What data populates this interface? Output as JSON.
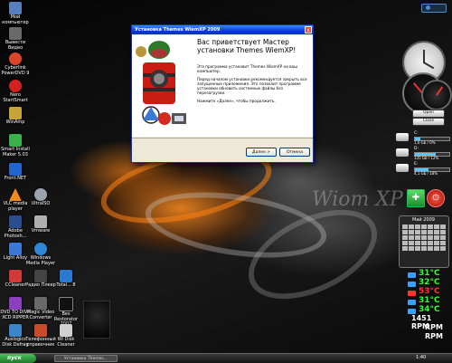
{
  "desktop": {
    "wallpaper_text": "Wiom XP",
    "icons": [
      {
        "label": "Мой компьютер",
        "color": "#5a7fbf"
      },
      {
        "label": "Вывести Видео",
        "color": "#6a6a6a"
      },
      {
        "label": "Cyberlink PowerDVD 9",
        "color": "#d9442a"
      },
      {
        "label": "Nero StartSmart",
        "color": "#d32020"
      },
      {
        "label": "WinAmp",
        "color": "#c7a43a"
      },
      {
        "label": "Smart Install Maker 5.03",
        "color": "#3cb04a"
      },
      {
        "label": "Front.NET",
        "color": "#2266cc"
      },
      {
        "label": "VLC media player",
        "color": "#f08a1c"
      },
      {
        "label": "UltraISO",
        "color": "#9aa3ad"
      },
      {
        "label": "Adobe Photosh...",
        "color": "#2a4d8f"
      },
      {
        "label": "Vmware",
        "color": "#b0b0b0"
      },
      {
        "label": "Light Alloy",
        "color": "#3a7ad4"
      },
      {
        "label": "Windows Media Player",
        "color": "#2f86d6"
      },
      {
        "label": "CCleaner",
        "color": "#d23a3a"
      },
      {
        "label": "Радио Плеер",
        "color": "#444444"
      },
      {
        "label": "Total... 8",
        "color": "#2b79d0"
      },
      {
        "label": "DVD TO DIVX XCD RIPPER",
        "color": "#8a3fbf"
      },
      {
        "label": "Magic Video Converter",
        "color": "#6a6a6a"
      },
      {
        "label": "Bes Restorator 2007",
        "color": "#111111"
      },
      {
        "label": "Auslogics Disk Defrag",
        "color": "#3a86c8"
      },
      {
        "label": "Телефонный справочник",
        "color": "#c94b2a"
      },
      {
        "label": "Wi Disk Cleaner",
        "color": "#d0d0d0"
      }
    ]
  },
  "dialog": {
    "title": "Установка Themes WiemXP 2009",
    "close": "x",
    "heading": "Вас приветствует Мастер установки Themes WiemXP!",
    "para1": "Эта программа установит Themes WiemXP на ваш компьютер.",
    "para2": "Перед началом установки рекомендуется закрыть все запущенные приложения. Это позволит программе установки обновить системные файлы без перезагрузки.",
    "para3": "Нажмите «Далее», чтобы продолжить.",
    "next_button": "Далее >",
    "cancel_button": "Отмена"
  },
  "gadgets": {
    "open_button": "Open",
    "close_button": "Close",
    "drives": [
      {
        "name": "С:",
        "info": "1,0 Gb / 0%",
        "fill": 0.15
      },
      {
        "name": "D:",
        "info": "135 Gb / 12%",
        "fill": 0.6
      },
      {
        "name": "E:",
        "info": "4,1 Gb / 18%",
        "fill": 0.4
      }
    ],
    "calendar_month": "Май 2009",
    "temps": [
      {
        "value": "31°C",
        "color": "#33ff33"
      },
      {
        "value": "32°C",
        "color": "#33ff33"
      },
      {
        "value": "53°C",
        "color": "#ff3333"
      },
      {
        "value": "31°C",
        "color": "#33ff33"
      },
      {
        "value": "34°C",
        "color": "#33ff33"
      }
    ],
    "rpm": [
      "1451 RPM",
      "RPM",
      "RPM"
    ]
  },
  "taskbar": {
    "start_label": "пуск",
    "task_label": "Установка Themes...",
    "clock": "1:40"
  }
}
